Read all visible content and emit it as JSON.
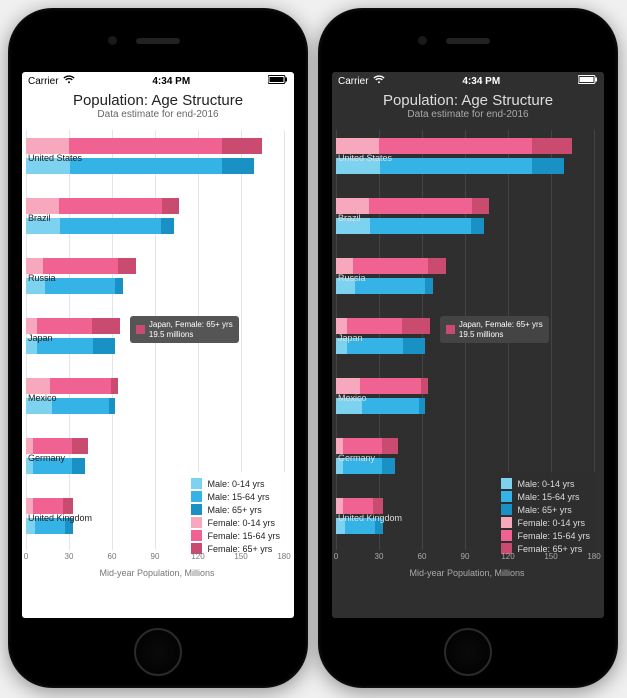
{
  "statusbar": {
    "carrier": "Carrier",
    "time": "4:34 PM"
  },
  "title": "Population: Age Structure",
  "subtitle": "Data estimate for end-2016",
  "xlabel": "Mid-year Population, Millions",
  "xticks": [
    0,
    30,
    60,
    90,
    120,
    150,
    180
  ],
  "legend": [
    {
      "label": "Male: 0-14 yrs",
      "color": "#7dd2f0"
    },
    {
      "label": "Male: 15-64 yrs",
      "color": "#35b3e6"
    },
    {
      "label": "Male: 65+ yrs",
      "color": "#1a91c4"
    },
    {
      "label": "Female: 0-14 yrs",
      "color": "#f7a8bd"
    },
    {
      "label": "Female: 15-64 yrs",
      "color": "#f06292"
    },
    {
      "label": "Female: 65+ yrs",
      "color": "#c94b6f"
    }
  ],
  "tooltip": {
    "line1": "Japan, Female: 65+ yrs",
    "line2": "19.5 millions",
    "swatch": "#c94b6f"
  },
  "colors": {
    "male": [
      "#7dd2f0",
      "#35b3e6",
      "#1a91c4"
    ],
    "female": [
      "#f7a8bd",
      "#f06292",
      "#c94b6f"
    ]
  },
  "chart_data": {
    "type": "bar",
    "orientation": "horizontal",
    "stacked": true,
    "grouped_by": "sex",
    "title": "Population: Age Structure",
    "subtitle": "Data estimate for end-2016",
    "xlabel": "Mid-year Population, Millions",
    "xlim": [
      0,
      180
    ],
    "xticks": [
      0,
      30,
      60,
      90,
      120,
      150,
      180
    ],
    "categories": [
      "United States",
      "Brazil",
      "Russia",
      "Japan",
      "Mexico",
      "Germany",
      "United Kingdom"
    ],
    "series": [
      {
        "name": "Male: 0-14 yrs",
        "sex": "male",
        "age": "0-14",
        "values": [
          31,
          24,
          13,
          8,
          18,
          5,
          6
        ]
      },
      {
        "name": "Male: 15-64 yrs",
        "sex": "male",
        "age": "15-64",
        "values": [
          106,
          70,
          49,
          39,
          40,
          27,
          21
        ]
      },
      {
        "name": "Male: 65+ yrs",
        "sex": "male",
        "age": "65+",
        "values": [
          22,
          9,
          6,
          15,
          4,
          9,
          6
        ]
      },
      {
        "name": "Female: 0-14 yrs",
        "sex": "female",
        "age": "0-14",
        "values": [
          30,
          23,
          12,
          8,
          17,
          5,
          5
        ]
      },
      {
        "name": "Female: 15-64 yrs",
        "sex": "female",
        "age": "15-64",
        "values": [
          107,
          72,
          52,
          38,
          42,
          27,
          21
        ]
      },
      {
        "name": "Female: 65+ yrs",
        "sex": "female",
        "age": "65+",
        "values": [
          28,
          12,
          13,
          19.5,
          5,
          11,
          7
        ]
      }
    ],
    "tooltip": {
      "category": "Japan",
      "series": "Female: 65+ yrs",
      "value": 19.5,
      "unit": "millions"
    }
  }
}
